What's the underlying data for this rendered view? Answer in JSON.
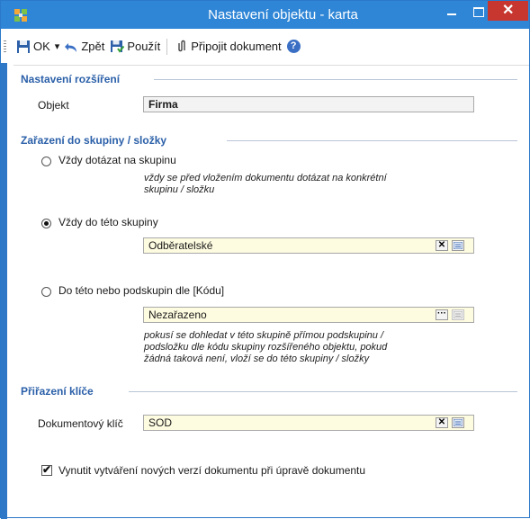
{
  "window": {
    "title": "Nastavení objektu - karta",
    "close_glyph": "✕"
  },
  "toolbar": {
    "ok_label": "OK",
    "ok_dropdown": "▾",
    "back_label": "Zpět",
    "apply_label": "Použít",
    "attach_label": "Připojit dokument",
    "help_glyph": "?"
  },
  "section_extension": {
    "title": "Nastavení rozšíření",
    "object_label": "Objekt",
    "object_value": "Firma"
  },
  "section_group": {
    "title": "Zařazení do skupiny / složky",
    "options": [
      {
        "label": "Vždy dotázat na skupinu",
        "checked": false,
        "hint_lines": [
          "vždy se před vložením dokumentu dotázat na konkrétní",
          "skupinu / složku"
        ]
      },
      {
        "label": "Vždy do této skupiny",
        "checked": true,
        "field_value": "Odběratelské"
      },
      {
        "label": "Do této nebo podskupin dle [Kódu]",
        "checked": false,
        "field_value": "Nezařazeno",
        "hint_lines": [
          "pokusí se dohledat v této skupině přímou podskupinu /",
          "podsložku dle kódu skupiny rozšířeného objektu, pokud",
          "žádná taková není, vloží se do této skupiny / složky"
        ]
      }
    ]
  },
  "section_key": {
    "title": "Přiřazení klíče",
    "key_label": "Dokumentový klíč",
    "key_value": "SOD"
  },
  "versioning": {
    "label": "Vynutit vytváření nových verzí dokumentu při úpravě dokumentu",
    "checked": true,
    "check_glyph": "✔"
  },
  "buttons": {
    "clear_glyph": "✕",
    "browse_glyph": "···"
  },
  "colors": {
    "titlebar": "#2f86d6",
    "close": "#c7372f",
    "section_title": "#2a5fa8",
    "field_yellow": "#fdfbe0"
  }
}
